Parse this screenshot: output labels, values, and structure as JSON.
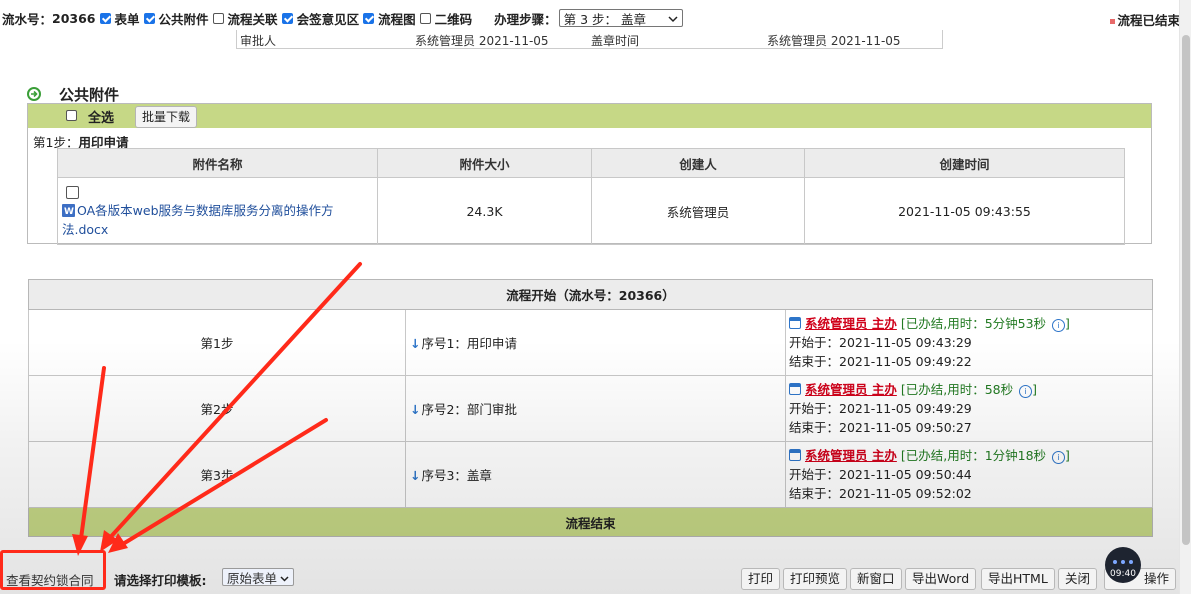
{
  "toolbar": {
    "serial_label": "流水号：",
    "serial_number": "20366",
    "options": [
      {
        "label": "表单",
        "checked": true
      },
      {
        "label": "公共附件",
        "checked": true
      },
      {
        "label": "流程关联",
        "checked": false
      },
      {
        "label": "会签意见区",
        "checked": true
      },
      {
        "label": "流程图",
        "checked": true
      },
      {
        "label": "二维码",
        "checked": false
      }
    ],
    "step_label": "办理步骤：",
    "step_select_value": "第 3 步：  盖章",
    "flow_status": "流程已结束"
  },
  "approval_row": {
    "approver_label": "审批人",
    "approver_value": "系统管理员 2021-11-05",
    "seal_time_label": "盖章时间",
    "seal_time_value": "系统管理员 2021-11-05"
  },
  "attachments": {
    "title": "公共附件",
    "select_all_label": "全选",
    "batch_download_label": "批量下载",
    "step_prefix": "第1步：",
    "step_name": "用印申请",
    "columns": [
      "附件名称",
      "附件大小",
      "创建人",
      "创建时间"
    ],
    "rows": [
      {
        "name": "OA各版本web服务与数据库服务分离的操作方法.docx",
        "size": "24.3K",
        "creator": "系统管理员",
        "created": "2021-11-05 09:43:55"
      }
    ]
  },
  "flow": {
    "start_label": "流程开始（流水号：20366）",
    "end_label": "流程结束",
    "steps": [
      {
        "step": "第1步",
        "seq": "序号1：用印申请",
        "handler": "系统管理员 主办",
        "status_prefix": "[已办结,用时：",
        "duration": "5分钟53秒",
        "status_suffix": "]",
        "start": "开始于：2021-11-05 09:43:29",
        "end": "结束于：2021-11-05 09:49:22"
      },
      {
        "step": "第2步",
        "seq": "序号2：部门审批",
        "handler": "系统管理员 主办",
        "status_prefix": "[已办结,用时：",
        "duration": "58秒",
        "status_suffix": "]",
        "start": "开始于：2021-11-05 09:49:29",
        "end": "结束于：2021-11-05 09:50:27"
      },
      {
        "step": "第3步",
        "seq": "序号3：盖章",
        "handler": "系统管理员 主办",
        "status_prefix": "[已办结,用时：",
        "duration": "1分钟18秒",
        "status_suffix": "]",
        "start": "开始于：2021-11-05 09:50:44",
        "end": "结束于：2021-11-05 09:52:02"
      }
    ]
  },
  "bottom": {
    "contract_link": "查看契约锁合同",
    "template_label": "请选择打印模板:",
    "template_value": "原始表单",
    "buttons": [
      "打印",
      "打印预览",
      "新窗口",
      "导出Word",
      "导出HTML",
      "关闭"
    ],
    "ops_label": "操作",
    "timer": "09:40"
  },
  "colors": {
    "accent_green": "#c6d886",
    "header_gray": "#ececec",
    "handler_red": "#d0021b",
    "status_green": "#227a22",
    "link_blue": "#1f4e9b",
    "annotation_red": "#ff2a1a"
  },
  "icons": [
    "arrow-circle-icon",
    "doc-icon",
    "down-arrow-icon",
    "person-icon",
    "info-icon",
    "chevron-down-icon"
  ]
}
